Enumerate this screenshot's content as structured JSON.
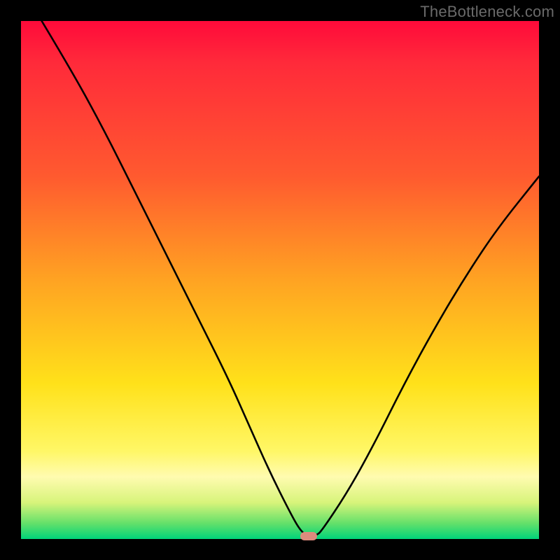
{
  "watermark": "TheBottleneck.com",
  "chart_data": {
    "type": "line",
    "title": "",
    "xlabel": "",
    "ylabel": "",
    "xlim": [
      0,
      100
    ],
    "ylim": [
      0,
      100
    ],
    "grid": false,
    "legend": false,
    "series": [
      {
        "name": "bottleneck-curve",
        "x": [
          4,
          10,
          16,
          22,
          28,
          34,
          40,
          44,
          48,
          52,
          54,
          55.5,
          57,
          58,
          63,
          68,
          74,
          80,
          86,
          92,
          100
        ],
        "y": [
          100,
          90,
          79,
          67,
          55,
          43,
          31,
          22,
          13,
          5,
          1.5,
          0.5,
          0.7,
          1.5,
          9,
          18,
          30,
          41,
          51,
          60,
          70
        ]
      }
    ],
    "marker": {
      "x": 55.5,
      "y": 0.6,
      "color": "#dd8b7d"
    },
    "gradient_stops": [
      {
        "pct": 0,
        "color": "#ff0a3a"
      },
      {
        "pct": 30,
        "color": "#ff5a2f"
      },
      {
        "pct": 50,
        "color": "#ffa322"
      },
      {
        "pct": 70,
        "color": "#ffe11a"
      },
      {
        "pct": 88,
        "color": "#fffbb0"
      },
      {
        "pct": 97,
        "color": "#63e06a"
      },
      {
        "pct": 100,
        "color": "#00d47a"
      }
    ]
  }
}
